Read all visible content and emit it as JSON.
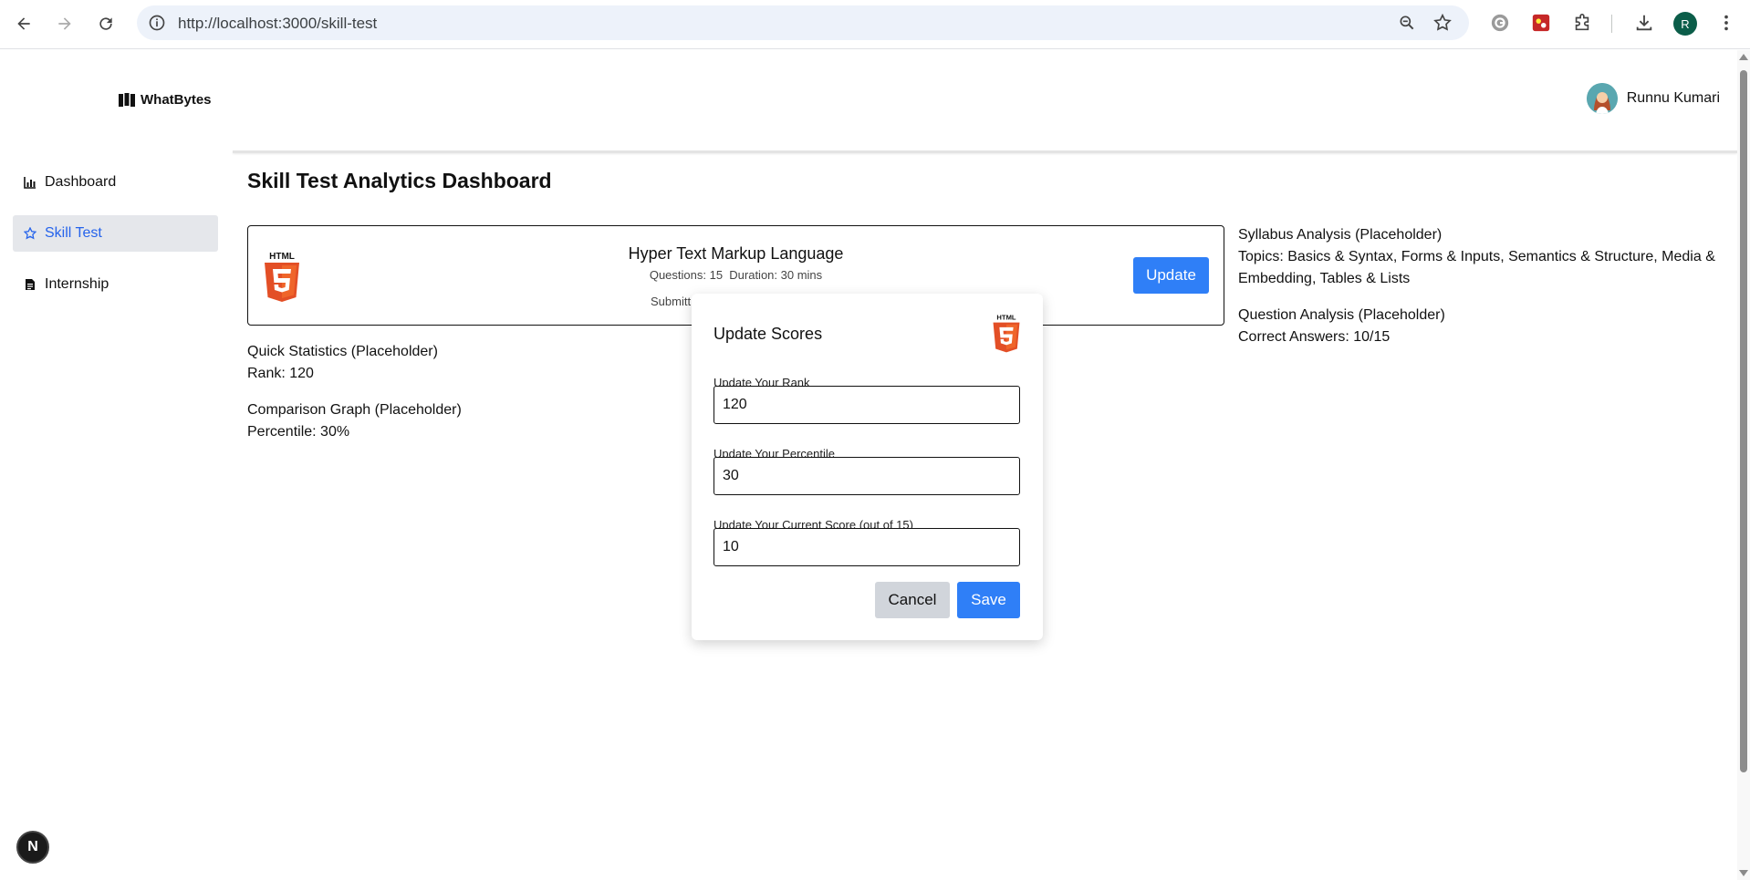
{
  "browser": {
    "url": "http://localhost:3000/skill-test",
    "profile_initial": "R"
  },
  "header": {
    "logo_text": "WhatBytes",
    "user_name": "Runnu Kumari"
  },
  "sidebar": {
    "items": [
      {
        "label": "Dashboard",
        "icon": "bar-chart-icon"
      },
      {
        "label": "Skill Test",
        "icon": "star-icon",
        "active": true
      },
      {
        "label": "Internship",
        "icon": "document-icon"
      }
    ]
  },
  "main": {
    "title": "Skill Test Analytics Dashboard",
    "test_card": {
      "title": "Hyper Text Markup Language",
      "meta": "Questions: 15  Duration: 30 mins",
      "submitted": "Submitt",
      "update_label": "Update",
      "logo_text": "HTML"
    },
    "quick_stats": {
      "heading": "Quick Statistics (Placeholder)",
      "rank": "Rank: 120"
    },
    "comparison": {
      "heading": "Comparison Graph (Placeholder)",
      "percentile": "Percentile: 30%"
    },
    "syllabus": {
      "heading": "Syllabus Analysis (Placeholder)",
      "topics": "Topics: Basics & Syntax, Forms & Inputs, Semantics & Structure, Media & Embedding, Tables & Lists"
    },
    "question_analysis": {
      "heading": "Question Analysis (Placeholder)",
      "correct": "Correct Answers: 10/15"
    }
  },
  "modal": {
    "title": "Update Scores",
    "logo_text": "HTML",
    "rank_label": "Update Your Rank",
    "rank_value": "120",
    "percentile_label": "Update Your Percentile",
    "percentile_value": "30",
    "score_label": "Update Your Current Score (out of 15)",
    "score_value": "10",
    "cancel_label": "Cancel",
    "save_label": "Save"
  },
  "next_badge": "N",
  "colors": {
    "accent": "#2f7ff7",
    "html5_orange": "#e34f26",
    "active_bg": "#e5e7eb"
  }
}
